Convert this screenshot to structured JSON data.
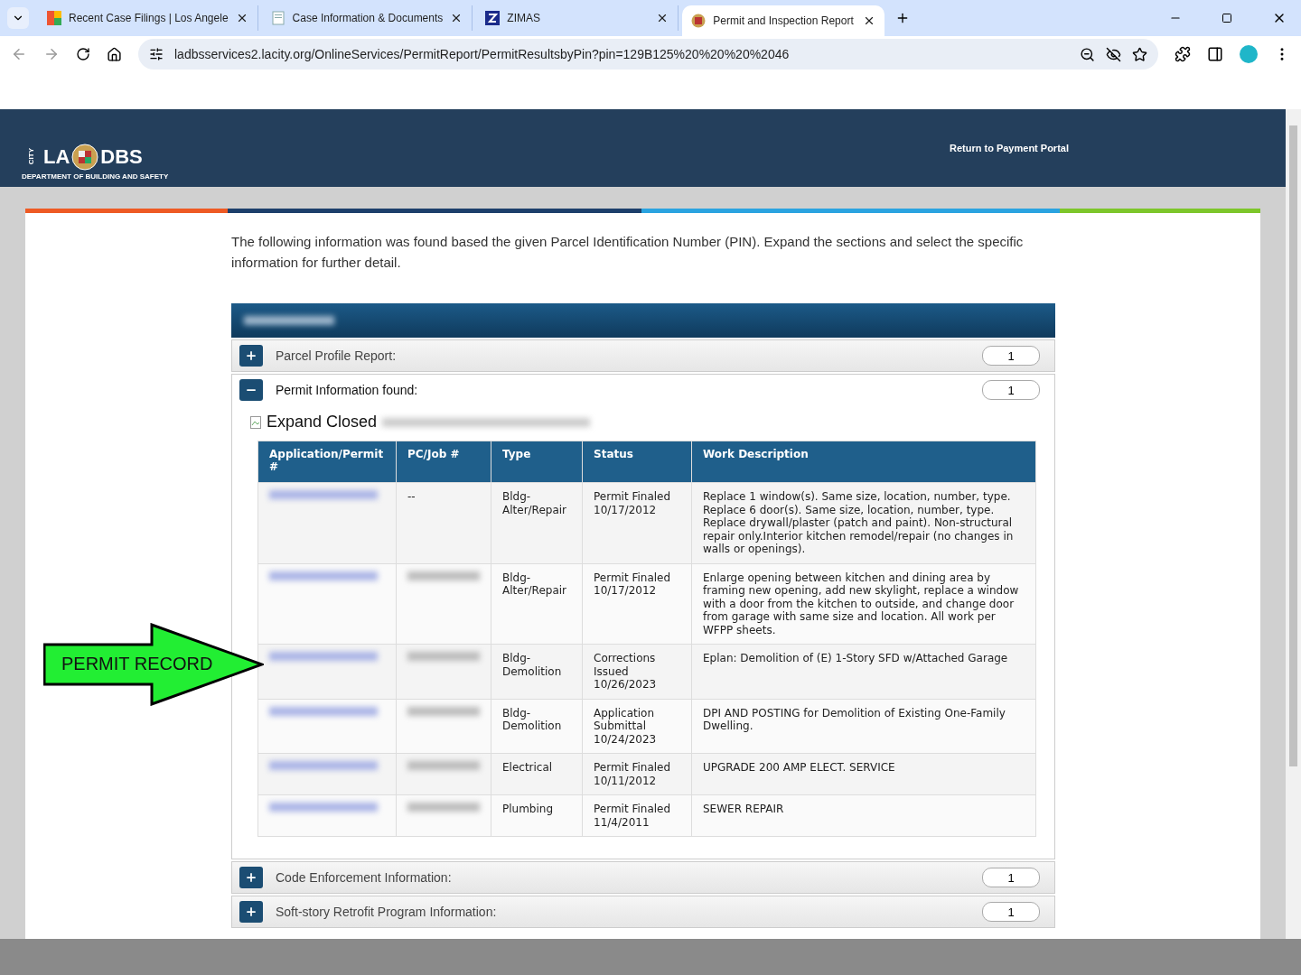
{
  "browser": {
    "tabs": [
      {
        "title": "Recent Case Filings | Los Angele",
        "selected": false,
        "kind": "mosaic"
      },
      {
        "title": "Case Information & Documents",
        "selected": false,
        "kind": "doc"
      },
      {
        "title": "ZIMAS",
        "selected": false,
        "kind": "z"
      },
      {
        "title": "Permit and Inspection Report",
        "selected": true,
        "kind": "seal"
      }
    ],
    "address": "ladbsservices2.lacity.org/OnlineServices/PermitReport/PermitResultsbyPin?pin=129B125%20%20%20%2046"
  },
  "header": {
    "logo": {
      "side": "CITY",
      "left": "LA",
      "right": "DBS",
      "caption": "DEPARTMENT OF BUILDING AND SAFETY"
    },
    "return_link": "Return to Payment Portal"
  },
  "intro": "The following information was found based the given Parcel Identification Number (PIN). Expand the sections and select the specific information for further detail.",
  "sections": [
    {
      "label": "Parcel Profile Report:",
      "count": "1",
      "expanded": false
    },
    {
      "label": "Permit Information found:",
      "count": "1",
      "expanded": true
    },
    {
      "label": "Code Enforcement Information:",
      "count": "1",
      "expanded": false
    },
    {
      "label": "Soft-story Retrofit Program Information:",
      "count": "1",
      "expanded": false
    }
  ],
  "permits": {
    "image_alt": "Expand Closed",
    "columns": [
      "Application/Permit #",
      "PC/Job #",
      "Type",
      "Status",
      "Work Description"
    ],
    "rows": [
      {
        "job": "--",
        "type": "Bldg-\nAlter/Repair",
        "status": "Permit Finaled\n10/17/2012",
        "description": "Replace 1 window(s). Same size, location, number, type. Replace 6 door(s). Same size, location, number, type. Replace drywall/plaster (patch and paint). Non-structural repair only.Interior kitchen remodel/repair (no changes in walls or openings)."
      },
      {
        "type": "Bldg-\nAlter/Repair",
        "status": "Permit Finaled\n10/17/2012",
        "description": "Enlarge opening between kitchen and dining area by framing new opening, add new skylight, replace a window with a door from the kitchen to outside, and change door from garage with same size and location. All work per WFPP sheets."
      },
      {
        "type": "Bldg-\nDemolition",
        "status": "Corrections\nIssued\n10/26/2023",
        "description": "Eplan: Demolition of (E) 1-Story SFD w/Attached Garage"
      },
      {
        "type": "Bldg-\nDemolition",
        "status": "Application\nSubmittal\n10/24/2023",
        "description": "DPI AND POSTING for Demolition of Existing One-Family Dwelling."
      },
      {
        "type": "Electrical",
        "status": "Permit Finaled\n10/11/2012",
        "description": "UPGRADE 200 AMP ELECT. SERVICE"
      },
      {
        "type": "Plumbing",
        "status": "Permit Finaled\n11/4/2011",
        "description": "SEWER REPAIR"
      }
    ]
  },
  "annotation": "PERMIT RECORD"
}
